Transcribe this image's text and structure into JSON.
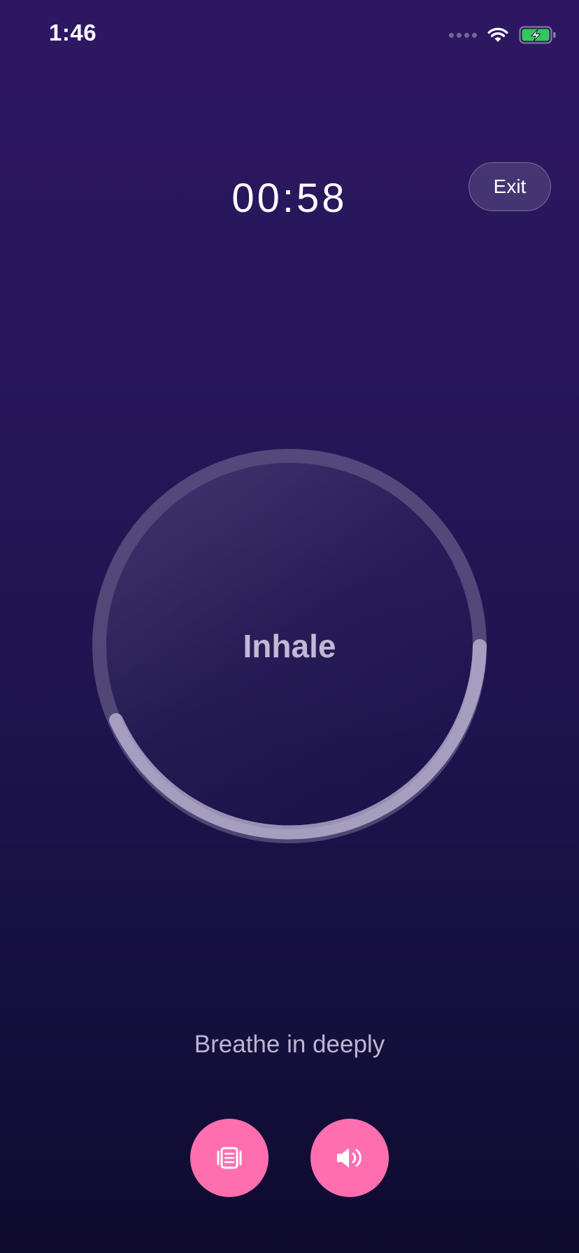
{
  "status_bar": {
    "time": "1:46",
    "signal_icon": "cellular-signal-icon",
    "wifi_icon": "wifi-icon",
    "battery_icon": "battery-charging-icon",
    "battery_color": "#34c759"
  },
  "session": {
    "timer": "00:58",
    "exit_label": "Exit"
  },
  "breathing": {
    "phase": "Inhale",
    "instruction": "Breathe in deeply"
  },
  "controls": {
    "vibrate_icon": "vibration-icon",
    "sound_icon": "speaker-icon",
    "button_color": "#ff6fb0"
  },
  "theme": {
    "background_top": "#2c1862",
    "background_bottom": "#0f0b2e"
  }
}
